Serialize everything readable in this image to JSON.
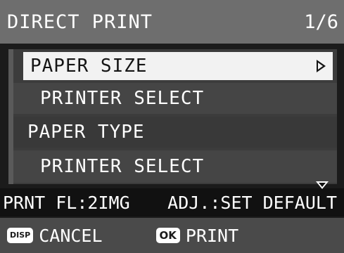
{
  "header": {
    "title": "DIRECT PRINT",
    "page": "1/6"
  },
  "menu": {
    "items": [
      {
        "label": "PAPER SIZE",
        "selected": true
      },
      {
        "label": "PRINTER SELECT",
        "indented": true
      },
      {
        "label": "PAPER TYPE"
      },
      {
        "label": "PRINTER SELECT",
        "indented": true
      }
    ]
  },
  "status": {
    "left": "PRNT FL:2IMG",
    "right": "ADJ.:SET DEFAULT"
  },
  "footer": {
    "cancel_key": "DISP",
    "cancel_label": "CANCEL",
    "print_key": "OK",
    "print_label": "PRINT"
  },
  "colors": {
    "header_bg": "#6e6e6e",
    "selected_bg": "#f2f2f2",
    "menu_bg": "#3c3c3c",
    "footer_bg": "#4a4a4a"
  }
}
